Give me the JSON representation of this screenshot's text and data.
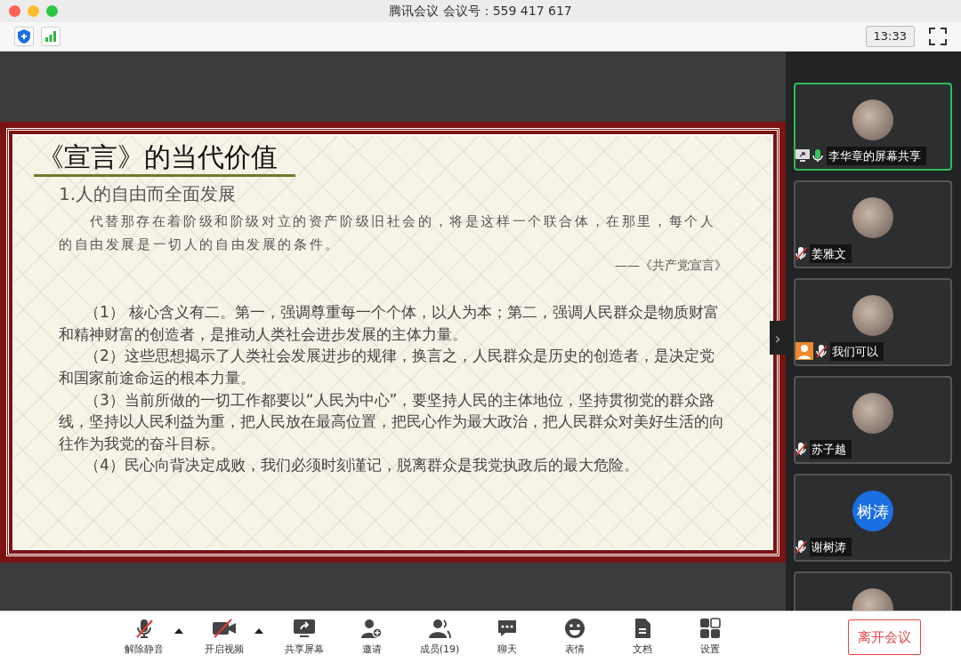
{
  "window": {
    "title": "腾讯会议 会议号：559 417 617"
  },
  "top_bar": {
    "clock": "13:33"
  },
  "slide": {
    "title": "《宣言》的当代价值",
    "subtitle": "1.人的自由而全面发展",
    "quote": "代替那存在着阶级和阶级对立的资产阶级旧社会的，将是这样一个联合体，在那里，每个人的自由发展是一切人的自由发展的条件。",
    "quote_source": "——《共产党宣言》",
    "paragraphs": [
      "（1） 核心含义有二。第一，强调尊重每一个个体，以人为本；第二，强调人民群众是物质财富和精神财富的创造者，是推动人类社会进步发展的主体力量。",
      "（2）这些思想揭示了人类社会发展进步的规律，换言之，人民群众是历史的创造者，是决定党和国家前途命运的根本力量。",
      "（3）当前所做的一切工作都要以“人民为中心”，要坚持人民的主体地位，坚持贯彻党的群众路线，坚持以人民利益为重，把人民放在最高位置，把民心作为最大政治，把人民群众对美好生活的向往作为我党的奋斗目标。",
      "（4）民心向背决定成败，我们必须时刻谨记，脱离群众是我党执政后的最大危险。"
    ]
  },
  "sidebar_handle": "›",
  "participants": [
    {
      "kind": "photo",
      "name": "李华章的屏幕共享",
      "muted": false,
      "speaking": true,
      "sharing": true
    },
    {
      "kind": "photo",
      "name": "姜雅文",
      "muted": true,
      "speaking": false
    },
    {
      "kind": "photo",
      "name": "我们可以",
      "muted": true,
      "speaking": false,
      "host": true
    },
    {
      "kind": "photo",
      "name": "苏子越",
      "muted": true,
      "speaking": false
    },
    {
      "kind": "initials",
      "initials": "树涛",
      "name": "谢树涛",
      "muted": true,
      "speaking": false
    },
    {
      "kind": "photo"
    }
  ],
  "toolbar": [
    {
      "kind": "mic",
      "label": "解除静音",
      "off": true,
      "caret": true
    },
    {
      "kind": "video",
      "label": "开启视频",
      "off": true,
      "caret": true
    },
    {
      "kind": "share",
      "label": "共享屏幕"
    },
    {
      "kind": "invite",
      "label": "邀请"
    },
    {
      "kind": "members",
      "label": "成员(19)"
    },
    {
      "kind": "chat",
      "label": "聊天"
    },
    {
      "kind": "emoji",
      "label": "表情"
    },
    {
      "kind": "doc",
      "label": "文档"
    },
    {
      "kind": "settings",
      "label": "设置"
    }
  ],
  "leave_button": "离开会议"
}
